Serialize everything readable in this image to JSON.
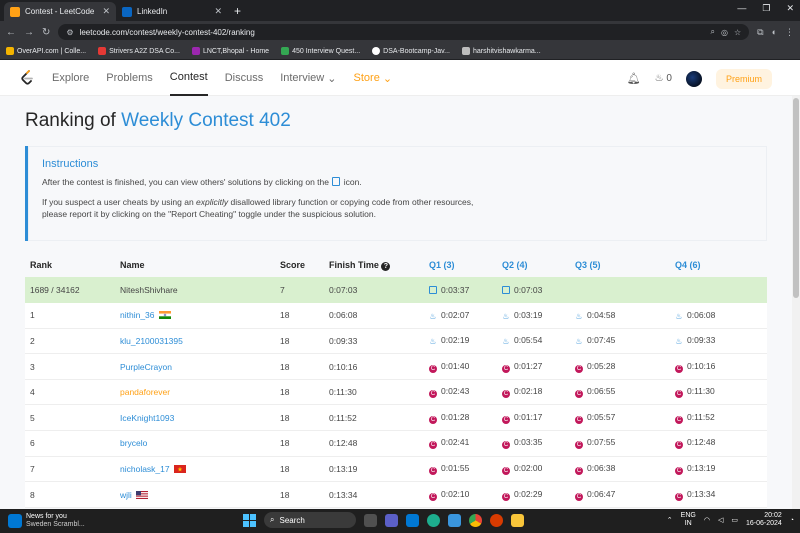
{
  "browser": {
    "tabs": [
      {
        "title": "Contest - LeetCode",
        "active": true,
        "favicon_color": "#ffa116"
      },
      {
        "title": "LinkedIn",
        "active": false,
        "favicon_color": "#0a66c2"
      }
    ],
    "url": "leetcode.com/contest/weekly-contest-402/ranking",
    "bookmarks": [
      {
        "label": "OverAPI.com | Colle...",
        "color": "#f4b400"
      },
      {
        "label": "Strivers A2Z DSA Co...",
        "color": "#e53935"
      },
      {
        "label": "LNCT,Bhopal - Home",
        "color": "#9c27b0"
      },
      {
        "label": "450 Interview Quest...",
        "color": "#34a853"
      },
      {
        "label": "DSA-Bootcamp-Jav...",
        "color": "#ffffff"
      },
      {
        "label": "harshitvishawkarma...",
        "color": "#bdbdbd"
      }
    ]
  },
  "nav": {
    "items": [
      "Explore",
      "Problems",
      "Contest",
      "Discuss",
      "Interview",
      "Store"
    ],
    "active": "Contest",
    "streak_count": "0",
    "premium_label": "Premium"
  },
  "page": {
    "title_prefix": "Ranking of",
    "title_contest": "Weekly Contest 402"
  },
  "instructions": {
    "heading": "Instructions",
    "line1_a": "After the contest is finished, you can view others' solutions by clicking on the",
    "line1_b": "icon.",
    "line2_a": "If you suspect a user cheats by using an",
    "line2_em": "explicitly",
    "line2_b": "disallowed library function or copying code from other resources,",
    "line3": "please report it by clicking on the \"Report Cheating\" toggle under the suspicious solution."
  },
  "table": {
    "headers": {
      "rank": "Rank",
      "name": "Name",
      "score": "Score",
      "finish": "Finish Time",
      "q1": "Q1 (3)",
      "q2": "Q2 (4)",
      "q3": "Q3 (5)",
      "q4": "Q4 (6)"
    },
    "rows": [
      {
        "rank": "1689 / 34162",
        "name": "NiteshShivhare",
        "score": "7",
        "finish": "0:07:03",
        "q1": "0:03:37",
        "q2": "0:07:03",
        "q3": "",
        "q4": "",
        "lang": "doc",
        "me": true,
        "flag": ""
      },
      {
        "rank": "1",
        "name": "nithin_36",
        "score": "18",
        "finish": "0:06:08",
        "q1": "0:02:07",
        "q2": "0:03:19",
        "q3": "0:04:58",
        "q4": "0:06:08",
        "lang": "java",
        "flag": "in"
      },
      {
        "rank": "2",
        "name": "klu_2100031395",
        "score": "18",
        "finish": "0:09:33",
        "q1": "0:02:19",
        "q2": "0:05:54",
        "q3": "0:07:45",
        "q4": "0:09:33",
        "lang": "java",
        "flag": ""
      },
      {
        "rank": "3",
        "name": "PurpleCrayon",
        "score": "18",
        "finish": "0:10:16",
        "q1": "0:01:40",
        "q2": "0:01:27",
        "q3": "0:05:28",
        "q4": "0:10:16",
        "lang": "cpp",
        "flag": ""
      },
      {
        "rank": "4",
        "name": "pandaforever",
        "score": "18",
        "finish": "0:11:30",
        "q1": "0:02:43",
        "q2": "0:02:18",
        "q3": "0:06:55",
        "q4": "0:11:30",
        "lang": "cpp",
        "flag": "",
        "orange": true
      },
      {
        "rank": "5",
        "name": "IceKnight1093",
        "score": "18",
        "finish": "0:11:52",
        "q1": "0:01:28",
        "q2": "0:01:17",
        "q3": "0:05:57",
        "q4": "0:11:52",
        "lang": "cpp",
        "flag": ""
      },
      {
        "rank": "6",
        "name": "brycelo",
        "score": "18",
        "finish": "0:12:48",
        "q1": "0:02:41",
        "q2": "0:03:35",
        "q3": "0:07:55",
        "q4": "0:12:48",
        "lang": "cpp",
        "flag": ""
      },
      {
        "rank": "7",
        "name": "nicholask_17",
        "score": "18",
        "finish": "0:13:19",
        "q1": "0:01:55",
        "q2": "0:02:00",
        "q3": "0:06:38",
        "q4": "0:13:19",
        "lang": "cpp",
        "flag": "vn"
      },
      {
        "rank": "8",
        "name": "wjli",
        "score": "18",
        "finish": "0:13:34",
        "q1": "0:02:10",
        "q2": "0:02:29",
        "q3": "0:06:47",
        "q4": "0:13:34",
        "lang": "cpp",
        "flag": "us"
      }
    ]
  },
  "taskbar": {
    "news_title": "News for you",
    "news_sub": "Sweden Scrambl...",
    "search_placeholder": "Search",
    "lang_line1": "ENG",
    "lang_line2": "IN",
    "time": "20:02",
    "date": "16-06-2024"
  }
}
